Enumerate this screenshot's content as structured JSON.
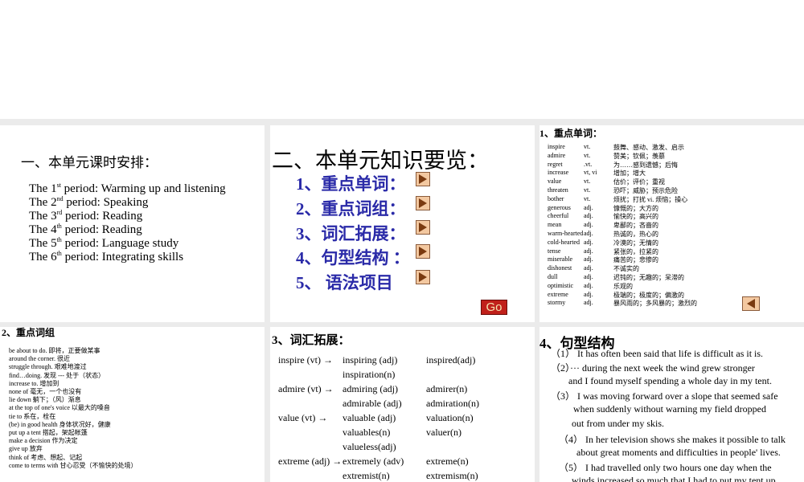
{
  "slide1": {
    "heading": "一、本单元课时安排：",
    "periods": [
      {
        "pre": "The 1",
        "sup": "st",
        "post": " period: Warming up and listening"
      },
      {
        "pre": "The 2",
        "sup": "nd",
        "post": " period: Speaking"
      },
      {
        "pre": "The 3",
        "sup": "rd",
        "post": " period: Reading"
      },
      {
        "pre": "The 4",
        "sup": "th",
        "post": " period: Reading"
      },
      {
        "pre": "The 5",
        "sup": "th",
        "post": " period: Language study"
      },
      {
        "pre": "The 6",
        "sup": "th",
        "post": " period: Integrating skills"
      }
    ]
  },
  "slide2": {
    "heading": "二、本单元知识要览：",
    "items": [
      "1、重点单词：",
      "2、重点词组：",
      "3、词汇拓展：",
      "4、句型结构 ：",
      "5、 语法项目"
    ],
    "go_label": "Go",
    "play_icon": "play-icon"
  },
  "slide3": {
    "heading": "1、重点单词：",
    "words": [
      {
        "word": "inspire",
        "pos": "vt.",
        "def": "鼓舞、感动、激发、启示"
      },
      {
        "word": "admire",
        "pos": "vt.",
        "def": "赞美；钦佩；羡慕"
      },
      {
        "word": "regret",
        "pos": ".vt.",
        "def": "为……感到遗憾；后悔"
      },
      {
        "word": "increase",
        "pos": "vt, vi",
        "def": "增加；增大"
      },
      {
        "word": "value",
        "pos": "vt.",
        "def": "估价；评价；重视"
      },
      {
        "word": "threaten",
        "pos": "vt.",
        "def": "恐吓；威胁；预示危险"
      },
      {
        "word": "bother",
        "pos": "vt.",
        "def": "烦扰；打扰 vi. 烦恼；操心"
      },
      {
        "word": "generous",
        "pos": "adj.",
        "def": "慷慨的；大方的"
      },
      {
        "word": "cheerful",
        "pos": "adj.",
        "def": "愉快的；高兴的"
      },
      {
        "word": "mean",
        "pos": "adj.",
        "def": "卑鄙的；吝啬的"
      },
      {
        "word": "warm-hearted",
        "pos": "adj.",
        "def": "热诚的，热心的"
      },
      {
        "word": "cold-hearted",
        "pos": "adj.",
        "def": "冷漠的；无情的"
      },
      {
        "word": "tense",
        "pos": "adj.",
        "def": "紧张的，拉紧的"
      },
      {
        "word": "miserable",
        "pos": "adj.",
        "def": "痛苦的；悲惨的"
      },
      {
        "word": "dishonest",
        "pos": "adj.",
        "def": "不诚实的"
      },
      {
        "word": "dull",
        "pos": "adj.",
        "def": "迟钝的；无趣的；呆滞的"
      },
      {
        "word": "optimistic",
        "pos": "adj.",
        "def": "乐观的"
      },
      {
        "word": "extreme",
        "pos": "adj.",
        "def": "极端的；极度的；偏激的"
      },
      {
        "word": "stormy",
        "pos": "adj.",
        "def": "暴风雨的；多风暴的；激烈的"
      }
    ],
    "back_icon": "back-arrow-icon"
  },
  "slide4": {
    "heading": "2、重点词组",
    "phrases": [
      "be about to do.   即将，正要做某事",
      "around the corner.  很近",
      "struggle through. 艰难地渡过",
      "find…doing.  发现 --- 处于（状态）",
      "increase to. 增加到",
      "none of 毫无，一个也没有",
      "lie down 躺下；（风）渐息",
      "at the top of one's voice 以最大的嗓音",
      "tie to 系在，栓在",
      "(be) in good health 身体状况好，健康",
      "put up a tent  搭起，架起帐篷",
      "make a decision 作为决定",
      "give up 放弃",
      "think of 考虑、想起、记起",
      "come to terms with 甘心忍受（不愉快的处境）"
    ]
  },
  "slide5": {
    "heading": "3、词汇拓展：",
    "rows": [
      [
        "inspire (vt)  →",
        "inspiring (adj)",
        "inspired(adj)"
      ],
      [
        "",
        "inspiration(n)",
        ""
      ],
      [
        "admire (vt) →",
        "admiring (adj)",
        "admirer(n)"
      ],
      [
        "",
        "admirable (adj)",
        "admiration(n)"
      ],
      [
        "value (vt)  →",
        "valuable (adj)",
        "valuation(n)"
      ],
      [
        "",
        "valuables(n)",
        "valuer(n)"
      ],
      [
        "",
        "valueless(adj)",
        ""
      ],
      [
        "extreme (adj) →",
        "extremely (adv)",
        "extreme(n)"
      ],
      [
        "",
        "extremist(n)",
        "extremism(n)"
      ]
    ]
  },
  "slide6": {
    "heading": "4、句型结构",
    "sentences": [
      "（1） It has often been said that life is difficult as it is.",
      "（2）··· during the next week the wind grew stronger",
      "and I found   myself spending a whole day in my tent.",
      "（3） I was moving forward over a slope that seemed safe",
      "when suddenly without warning my field dropped",
      "out from under my skis.",
      "（4） In her television shows she makes it possible to talk",
      "about great moments and difficulties in people' lives.",
      "（5） I had travelled only two hours one day when the",
      "winds increased so much that I had to put my tent up."
    ]
  }
}
